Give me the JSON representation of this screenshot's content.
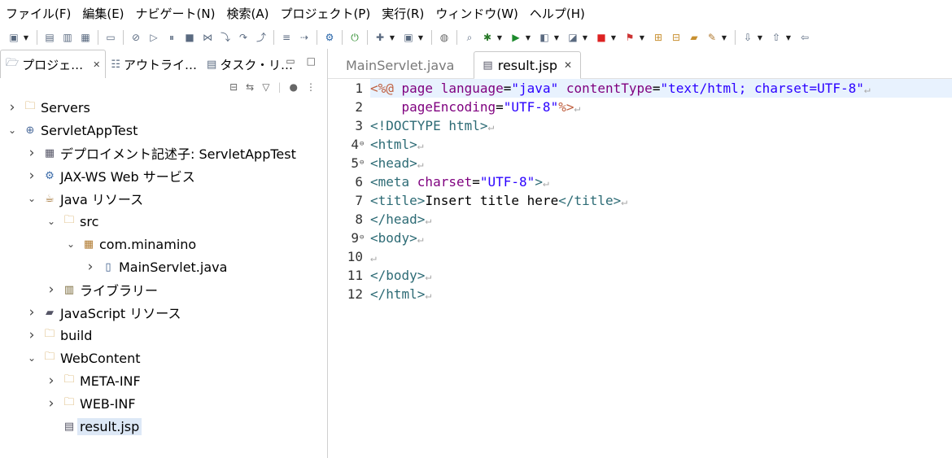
{
  "menu": [
    "ファイル(F)",
    "編集(E)",
    "ナビゲート(N)",
    "検索(A)",
    "プロジェクト(P)",
    "実行(R)",
    "ウィンドウ(W)",
    "ヘルプ(H)"
  ],
  "toolbar_icons": [
    "new-icon",
    "save-icon",
    "save-all-icon",
    "terminal-icon",
    "console-icon",
    "skip-icon",
    "resume-icon",
    "suspend-icon",
    "stop-icon",
    "disconnect-icon",
    "step-into-icon",
    "step-over-icon",
    "step-return-icon",
    "toggle-icon",
    "tasks-icon",
    "settings-icon",
    "run-server-icon",
    "new-server-icon",
    "server-icon",
    "globe-icon",
    "search-icon",
    "debug-icon",
    "run-icon",
    "coverage-icon",
    "external-tools-icon",
    "stop-red-icon",
    "profile-icon",
    "open-type-icon",
    "open-folder-icon",
    "folder-icon",
    "brush-icon",
    "next-annotation-icon",
    "prev-annotation-icon",
    "back-icon"
  ],
  "left_panel": {
    "tabs": [
      {
        "label": "プロジェ…",
        "icon": "project-explorer-icon",
        "active": true
      },
      {
        "label": "アウトライ…",
        "icon": "outline-icon",
        "active": false
      },
      {
        "label": "タスク・リ…",
        "icon": "task-list-icon",
        "active": false
      }
    ],
    "tree": [
      {
        "label": "Servers",
        "level": 0,
        "expanded": false,
        "icon": "folder-icon"
      },
      {
        "label": "ServletAppTest",
        "level": 0,
        "expanded": true,
        "icon": "web-project-icon"
      },
      {
        "label": "デプロイメント記述子: ServletAppTest",
        "level": 1,
        "expanded": false,
        "icon": "deployment-descriptor-icon"
      },
      {
        "label": "JAX-WS Web サービス",
        "level": 1,
        "expanded": false,
        "icon": "web-service-icon"
      },
      {
        "label": "Java リソース",
        "level": 1,
        "expanded": true,
        "icon": "java-resources-icon"
      },
      {
        "label": "src",
        "level": 2,
        "expanded": true,
        "icon": "source-folder-icon"
      },
      {
        "label": "com.minamino",
        "level": 3,
        "expanded": true,
        "icon": "package-icon"
      },
      {
        "label": "MainServlet.java",
        "level": 4,
        "expanded": false,
        "icon": "java-file-icon"
      },
      {
        "label": "ライブラリー",
        "level": 2,
        "expanded": false,
        "icon": "library-icon"
      },
      {
        "label": "JavaScript リソース",
        "level": 1,
        "expanded": false,
        "icon": "javascript-resources-icon"
      },
      {
        "label": "build",
        "level": 1,
        "expanded": false,
        "icon": "folder-icon"
      },
      {
        "label": "WebContent",
        "level": 1,
        "expanded": true,
        "icon": "folder-icon"
      },
      {
        "label": "META-INF",
        "level": 2,
        "expanded": false,
        "icon": "folder-icon"
      },
      {
        "label": "WEB-INF",
        "level": 2,
        "expanded": false,
        "icon": "folder-icon"
      },
      {
        "label": "result.jsp",
        "level": 2,
        "expanded": null,
        "icon": "jsp-file-icon",
        "selected": true
      }
    ]
  },
  "editor": {
    "tabs": [
      {
        "label": "MainServlet.java",
        "active": false
      },
      {
        "label": "result.jsp",
        "active": true
      }
    ],
    "line_numbers": [
      "1",
      "2",
      "3",
      "4",
      "5",
      "6",
      "7",
      "8",
      "9",
      "10",
      "11",
      "12"
    ],
    "fold_lines": [
      "4",
      "5",
      "9"
    ],
    "lines": [
      [
        [
          "dir",
          "<%@ "
        ],
        [
          "dirkw",
          "page "
        ],
        [
          "attr",
          "language"
        ],
        [
          "txt",
          "="
        ],
        [
          "val",
          "\"java\""
        ],
        [
          "txt",
          " "
        ],
        [
          "attr",
          "contentType"
        ],
        [
          "txt",
          "="
        ],
        [
          "val",
          "\"text/html; charset=UTF-8\""
        ]
      ],
      [
        [
          "txt",
          "    "
        ],
        [
          "attr",
          "pageEncoding"
        ],
        [
          "txt",
          "="
        ],
        [
          "val",
          "\"UTF-8\""
        ],
        [
          "dir",
          "%>"
        ]
      ],
      [
        [
          "tag",
          "<!DOCTYPE html>"
        ]
      ],
      [
        [
          "tag",
          "<html>"
        ]
      ],
      [
        [
          "tag",
          "<head>"
        ]
      ],
      [
        [
          "tag",
          "<meta "
        ],
        [
          "attr",
          "charset"
        ],
        [
          "txt",
          "="
        ],
        [
          "val",
          "\"UTF-8\""
        ],
        [
          "tag",
          ">"
        ]
      ],
      [
        [
          "tag",
          "<title>"
        ],
        [
          "txt",
          "Insert title here"
        ],
        [
          "tag",
          "</title>"
        ]
      ],
      [
        [
          "tag",
          "</head>"
        ]
      ],
      [
        [
          "tag",
          "<body>"
        ]
      ],
      [],
      [
        [
          "tag",
          "</body>"
        ]
      ],
      [
        [
          "tag",
          "</html>"
        ]
      ]
    ],
    "pilcrow": "↵"
  }
}
